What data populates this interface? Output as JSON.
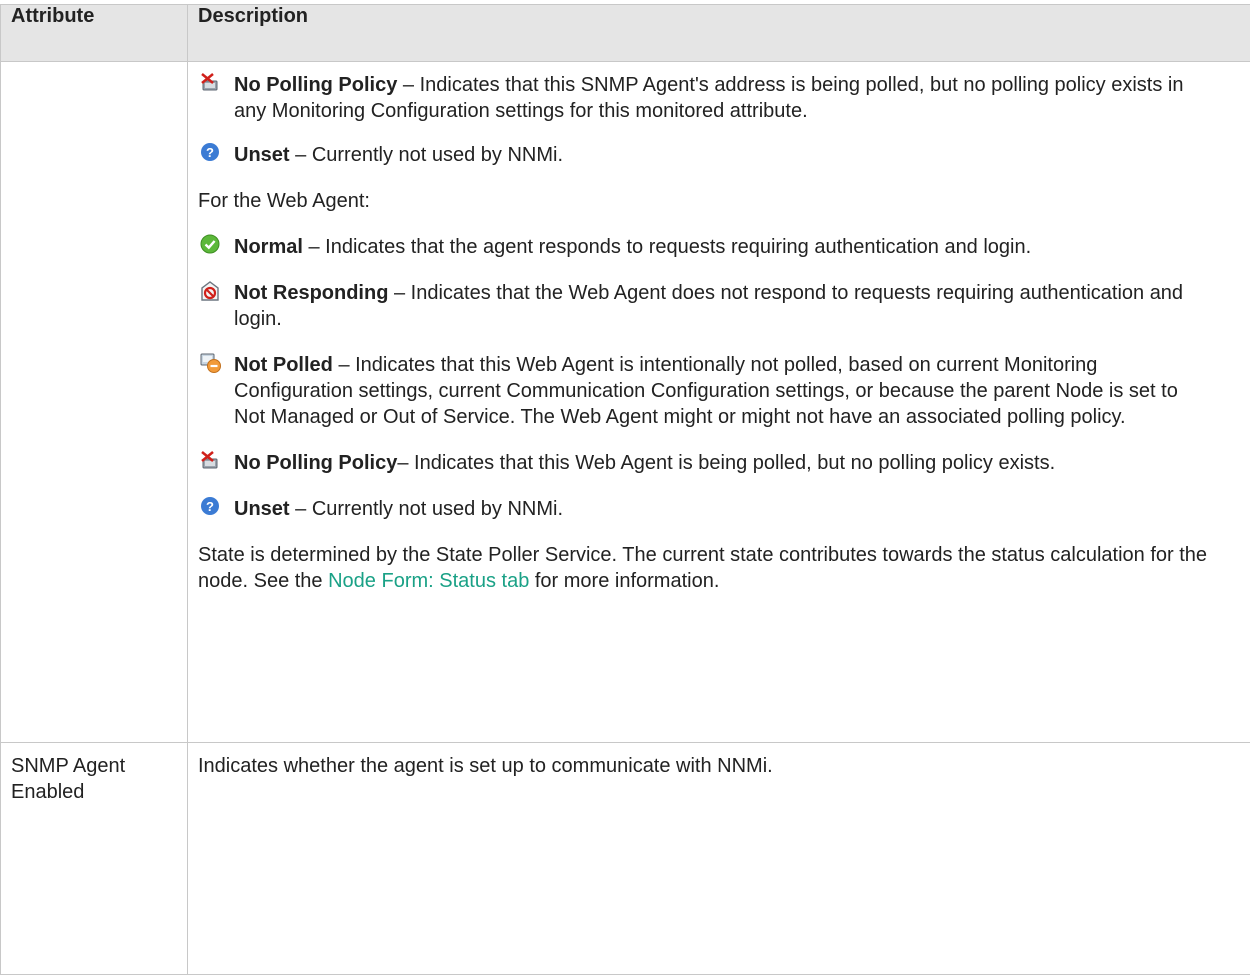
{
  "table": {
    "headers": [
      "Attribute",
      "Description"
    ],
    "row1": {
      "attribute": "",
      "snmp_no_polling": {
        "name": "No Polling Policy",
        "text": " – Indicates that this SNMP Agent's address is being polled, but no polling policy exists in any Monitoring Configuration settings for this monitored attribute."
      },
      "snmp_unset": {
        "name": "Unset",
        "text": " – Currently not used by NNMi."
      },
      "web_intro": "For the Web Agent:",
      "web_normal": {
        "name": "Normal",
        "text": " – Indicates that the agent responds to requests requiring authentication and login."
      },
      "web_not_responding": {
        "name": "Not Responding",
        "text": " – Indicates that the Web Agent does not respond to requests requiring authentication and login."
      },
      "web_not_polled": {
        "name": "Not Polled",
        "text": " – Indicates that this Web Agent is intentionally not polled, based on current Monitoring Configuration settings, current Communication Configuration settings, or because the parent Node is set to Not Managed or Out of Service. The Web Agent might or might not have an associated polling policy."
      },
      "web_no_polling": {
        "name": "No Polling Policy",
        "text": "– Indicates that this Web Agent is being polled, but no polling policy exists."
      },
      "web_unset": {
        "name": "Unset",
        "text": " – Currently not used by NNMi."
      },
      "footer": {
        "before": "State is determined by the State Poller Service. The current state contributes towards the status calculation for the node. See the ",
        "link": "Node Form: Status tab",
        "after": " for more information."
      }
    },
    "row2": {
      "attribute": "SNMP Agent Enabled",
      "description": "Indicates whether the agent is set up to communicate with NNMi."
    }
  },
  "icons": {
    "no_polling_policy": "no-polling-policy-icon",
    "unset": "unset-question-icon",
    "normal": "normal-check-icon",
    "not_responding": "not-responding-icon",
    "not_polled": "not-polled-icon"
  },
  "colors": {
    "link": "#1aa186",
    "header_bg": "#e5e5e5",
    "normal_green": "#5cb83a",
    "unset_blue": "#3b7bd4",
    "alert_red": "#d0201a"
  }
}
